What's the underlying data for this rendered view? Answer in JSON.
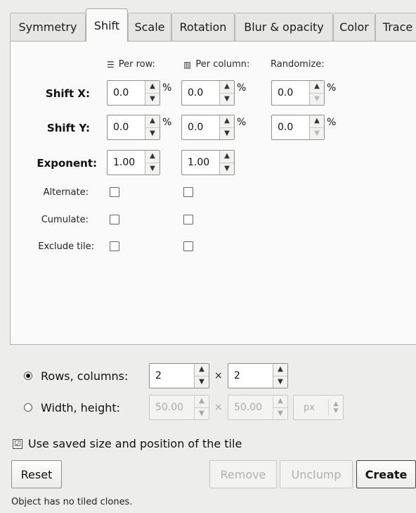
{
  "tabs": [
    {
      "label": "Symmetry",
      "active": false
    },
    {
      "label": "Shift",
      "active": true
    },
    {
      "label": "Scale",
      "active": false
    },
    {
      "label": "Rotation",
      "active": false
    },
    {
      "label": "Blur & opacity",
      "active": false
    },
    {
      "label": "Color",
      "active": false
    },
    {
      "label": "Trace",
      "active": false
    }
  ],
  "columns": {
    "per_row": "Per row:",
    "per_column": "Per column:",
    "randomize": "Randomize:"
  },
  "rows": {
    "shift_x": {
      "label": "Shift X:",
      "per_row": "0.0",
      "per_column": "0.0",
      "randomize": "0.0",
      "unit": "%"
    },
    "shift_y": {
      "label": "Shift Y:",
      "per_row": "0.0",
      "per_column": "0.0",
      "randomize": "0.0",
      "unit": "%"
    },
    "exponent": {
      "label": "Exponent:",
      "per_row": "1.00",
      "per_column": "1.00"
    },
    "alternate": {
      "label": "Alternate:"
    },
    "cumulate": {
      "label": "Cumulate:"
    },
    "exclude_tile": {
      "label": "Exclude tile:"
    }
  },
  "layout_options": {
    "rows_columns": {
      "label": "Rows, columns:",
      "rows": "2",
      "columns": "2",
      "selected": true
    },
    "width_height": {
      "label": "Width, height:",
      "width": "50.00",
      "height": "50.00",
      "unit": "px",
      "selected": false
    },
    "times": "×"
  },
  "use_saved": {
    "label": "Use saved size and position of the tile",
    "checked": true,
    "mark": "☑"
  },
  "buttons": {
    "reset": "Reset",
    "remove": "Remove",
    "unclump": "Unclump",
    "create": "Create"
  },
  "status": "Object has no tiled clones."
}
